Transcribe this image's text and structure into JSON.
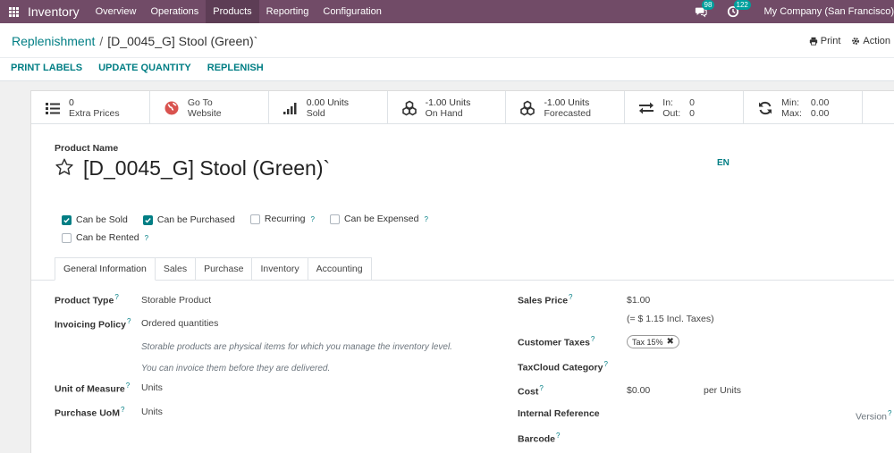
{
  "nav": {
    "app_name": "Inventory",
    "menus": [
      "Overview",
      "Operations",
      "Products",
      "Reporting",
      "Configuration"
    ],
    "active_menu": "Products",
    "messages_count": "98",
    "activities_count": "122",
    "company": "My Company (San Francisco)"
  },
  "breadcrumb": {
    "parent": "Replenishment",
    "separator": "/",
    "current": "[D_0045_G] Stool (Green)`"
  },
  "actions": {
    "print": "Print",
    "action": "Action"
  },
  "statusbar": {
    "print_labels": "PRINT LABELS",
    "update_quantity": "UPDATE QUANTITY",
    "replenish": "REPLENISH"
  },
  "smart_buttons": {
    "extra_prices": {
      "value": "0",
      "label": "Extra Prices"
    },
    "website": {
      "line1": "Go To",
      "line2": "Website"
    },
    "sold": {
      "value": "0.00 Units",
      "label": "Sold"
    },
    "on_hand": {
      "value": "-1.00 Units",
      "label": "On Hand"
    },
    "forecasted": {
      "value": "-1.00 Units",
      "label": "Forecasted"
    },
    "in_out": {
      "in_label": "In:",
      "in_value": "0",
      "out_label": "Out:",
      "out_value": "0"
    },
    "min_max": {
      "min_label": "Min:",
      "min_value": "0.00",
      "max_label": "Max:",
      "max_value": "0.00"
    }
  },
  "product": {
    "name_label": "Product Name",
    "name": "[D_0045_G] Stool (Green)`",
    "lang": "EN"
  },
  "checkboxes": {
    "can_be_sold": {
      "label": "Can be Sold",
      "checked": true
    },
    "can_be_purchased": {
      "label": "Can be Purchased",
      "checked": true
    },
    "recurring": {
      "label": "Recurring",
      "checked": false
    },
    "can_be_expensed": {
      "label": "Can be Expensed",
      "checked": false
    },
    "can_be_rented": {
      "label": "Can be Rented",
      "checked": false
    },
    "help_mark": "?"
  },
  "tabs": [
    "General Information",
    "Sales",
    "Purchase",
    "Inventory",
    "Accounting"
  ],
  "left_fields": {
    "product_type": {
      "label": "Product Type",
      "value": "Storable Product"
    },
    "invoicing_policy": {
      "label": "Invoicing Policy",
      "value": "Ordered quantities"
    },
    "note1": "Storable products are physical items for which you manage the inventory level.",
    "note2": "You can invoice them before they are delivered.",
    "unit_of_measure": {
      "label": "Unit of Measure",
      "value": "Units"
    },
    "purchase_uom": {
      "label": "Purchase UoM",
      "value": "Units"
    }
  },
  "right_fields": {
    "sales_price": {
      "label": "Sales Price",
      "value": "$1.00",
      "incl": "(= $ 1.15 Incl. Taxes)"
    },
    "customer_taxes": {
      "label": "Customer Taxes",
      "tag": "Tax 15%"
    },
    "taxcloud_category": {
      "label": "TaxCloud Category"
    },
    "cost": {
      "label": "Cost",
      "value": "$0.00",
      "unit": "per Units"
    },
    "internal_reference": {
      "label": "Internal Reference"
    },
    "barcode": {
      "label": "Barcode"
    },
    "version": "Version"
  },
  "colors": {
    "navbar": "#714b67",
    "accent": "#017e84",
    "badge": "#00a09d"
  }
}
